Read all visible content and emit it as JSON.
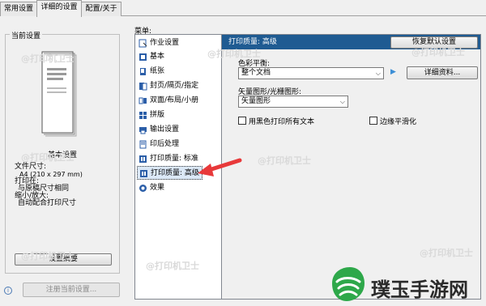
{
  "tabs": [
    {
      "label": "常用设置"
    },
    {
      "label": "详细的设置"
    },
    {
      "label": "配置/关于"
    }
  ],
  "left": {
    "group_title": "当前设置",
    "preview_caption": "基本设置",
    "paper_size_label": "文件尺寸:",
    "paper_size_value": "A4 (210 x 297 mm)",
    "print_on_label": "打印在:",
    "print_on_value": "与原稿尺寸相同",
    "scale_label": "缩小/放大:",
    "scale_value": "自动配合打印尺寸",
    "summary_button": "设置摘要",
    "register_button": "注册当前设置...",
    "info_icon": "info-icon"
  },
  "menu": {
    "title": "菜单:",
    "items": [
      {
        "label": "作业设置",
        "icon": "job-icon"
      },
      {
        "label": "基本",
        "icon": "basic-icon"
      },
      {
        "label": "纸张",
        "icon": "paper-icon"
      },
      {
        "label": "封页/隔页/指定",
        "icon": "cover-icon"
      },
      {
        "label": "双面/布局/小册",
        "icon": "duplex-icon"
      },
      {
        "label": "拼版",
        "icon": "imposition-icon"
      },
      {
        "label": "输出设置",
        "icon": "output-icon"
      },
      {
        "label": "印后处理",
        "icon": "finishing-icon"
      },
      {
        "label": "打印质量: 标准",
        "icon": "quality-standard-icon"
      },
      {
        "label": "打印质量: 高级",
        "icon": "quality-advanced-icon"
      },
      {
        "label": "效果",
        "icon": "effects-icon"
      }
    ],
    "selected_index": 9
  },
  "panel": {
    "header": "打印质量: 高级",
    "restore_button": "恢复默认设置",
    "color_balance_label": "色彩平衡:",
    "color_balance_value": "整个文档",
    "details_button": "详细资料...",
    "vector_label": "矢量图形/光栅图形:",
    "vector_value": "矢量图形",
    "black_text_label": "用黑色打印所有文本",
    "black_text_checked": false,
    "edge_smooth_label": "边缘平滑化",
    "edge_smooth_checked": false
  },
  "watermarks": [
    "@打印机卫士"
  ],
  "brand": {
    "name": "璞玉手游网",
    "colors": {
      "green": "#2ea84a",
      "accent": "#e8393a",
      "header": "#1f5b92"
    }
  }
}
